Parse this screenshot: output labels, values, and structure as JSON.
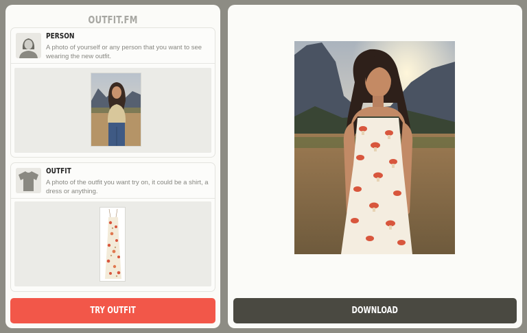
{
  "app": {
    "title": "OUTFIT.FM"
  },
  "person_card": {
    "label": "PERSON",
    "description": "A photo of yourself or any person that you want to see wearing the new outfit.",
    "icon": "person-silhouette-icon"
  },
  "outfit_card": {
    "label": "OUTFIT",
    "description": "A photo of the outfit you want try on, it could be a shirt, a dress or anything.",
    "icon": "shirt-icon"
  },
  "actions": {
    "try_label": "TRY OUTFIT",
    "download_label": "DOWNLOAD"
  },
  "colors": {
    "accent": "#f25749",
    "download": "#4a4941",
    "background": "#8d8c84",
    "panel": "#fbfbf8"
  }
}
